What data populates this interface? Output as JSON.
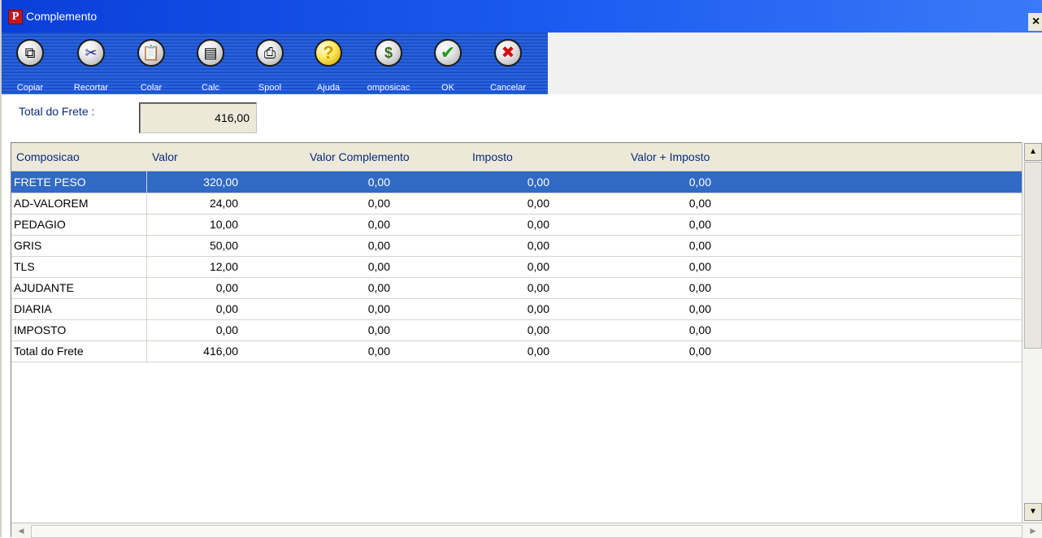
{
  "window": {
    "title": "Complemento",
    "logo_letter": "P",
    "close_glyph": "×"
  },
  "toolbar": {
    "buttons": [
      {
        "label": "Copiar",
        "icon": "copy-icon",
        "glyph": "⧉",
        "color": "#333333"
      },
      {
        "label": "Recortar",
        "icon": "scissors-icon",
        "glyph": "✂",
        "color": "#1a1a8a"
      },
      {
        "label": "Colar",
        "icon": "paste-icon",
        "glyph": "📋",
        "color": "#333333"
      },
      {
        "label": "Calc",
        "icon": "calculator-icon",
        "glyph": "▤",
        "color": "#333333"
      },
      {
        "label": "Spool",
        "icon": "printer-icon",
        "glyph": "⎙",
        "color": "#333333"
      },
      {
        "label": "Ajuda",
        "icon": "help-icon",
        "glyph": "?",
        "color": "#c8a000"
      },
      {
        "label": "omposicac",
        "icon": "composition-box-icon",
        "glyph": "$",
        "color": "#3a6a20"
      },
      {
        "label": "OK",
        "icon": "checkmark-icon",
        "glyph": "✔",
        "color": "#1f9a1f"
      },
      {
        "label": "Cancelar",
        "icon": "cancel-x-icon",
        "glyph": "✖",
        "color": "#d41010"
      }
    ]
  },
  "total": {
    "label": "Total do Frete :",
    "value": "416,00"
  },
  "grid": {
    "columns": [
      "Composicao",
      "Valor",
      "Valor Complemento",
      "Imposto",
      "Valor + Imposto"
    ],
    "rows": [
      [
        "FRETE PESO",
        "320,00",
        "0,00",
        "0,00",
        "0,00"
      ],
      [
        "AD-VALOREM",
        "24,00",
        "0,00",
        "0,00",
        "0,00"
      ],
      [
        "PEDAGIO",
        "10,00",
        "0,00",
        "0,00",
        "0,00"
      ],
      [
        "GRIS",
        "50,00",
        "0,00",
        "0,00",
        "0,00"
      ],
      [
        "TLS",
        "12,00",
        "0,00",
        "0,00",
        "0,00"
      ],
      [
        "AJUDANTE",
        "0,00",
        "0,00",
        "0,00",
        "0,00"
      ],
      [
        "DIARIA",
        "0,00",
        "0,00",
        "0,00",
        "0,00"
      ],
      [
        "IMPOSTO",
        "0,00",
        "0,00",
        "0,00",
        "0,00"
      ],
      [
        "Total do Frete",
        "416,00",
        "0,00",
        "0,00",
        "0,00"
      ]
    ],
    "selected_row": 0
  },
  "colors": {
    "titlebar": "#0a3ed8",
    "selection": "#316ac5",
    "header_text": "#0a2a7a"
  }
}
